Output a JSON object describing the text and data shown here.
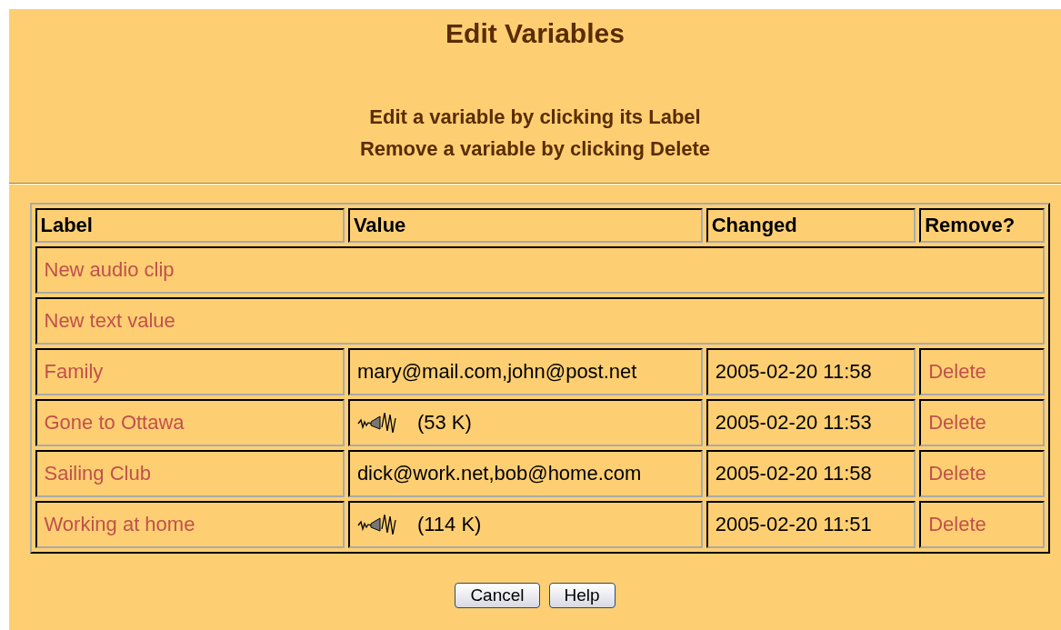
{
  "title": "Edit Variables",
  "instructions": [
    "Edit a variable by clicking its Label",
    "Remove a variable by clicking Delete"
  ],
  "table": {
    "columns": [
      "Label",
      "Value",
      "Changed",
      "Remove?"
    ],
    "rows": [
      {
        "kind": "new",
        "label": "New audio clip"
      },
      {
        "kind": "new",
        "label": "New text value"
      },
      {
        "kind": "text",
        "label": "Family",
        "value": "mary@mail.com,john@post.net",
        "changed": "2005-02-20 11:58",
        "remove": "Delete"
      },
      {
        "kind": "audio",
        "label": "Gone to Ottawa",
        "value": "(53 K)",
        "changed": "2005-02-20 11:53",
        "remove": "Delete"
      },
      {
        "kind": "text",
        "label": "Sailing Club",
        "value": "dick@work.net,bob@home.com",
        "changed": "2005-02-20 11:58",
        "remove": "Delete"
      },
      {
        "kind": "audio",
        "label": "Working at home",
        "value": "(114 K)",
        "changed": "2005-02-20 11:51",
        "remove": "Delete"
      }
    ]
  },
  "buttons": [
    "Cancel",
    "Help"
  ]
}
